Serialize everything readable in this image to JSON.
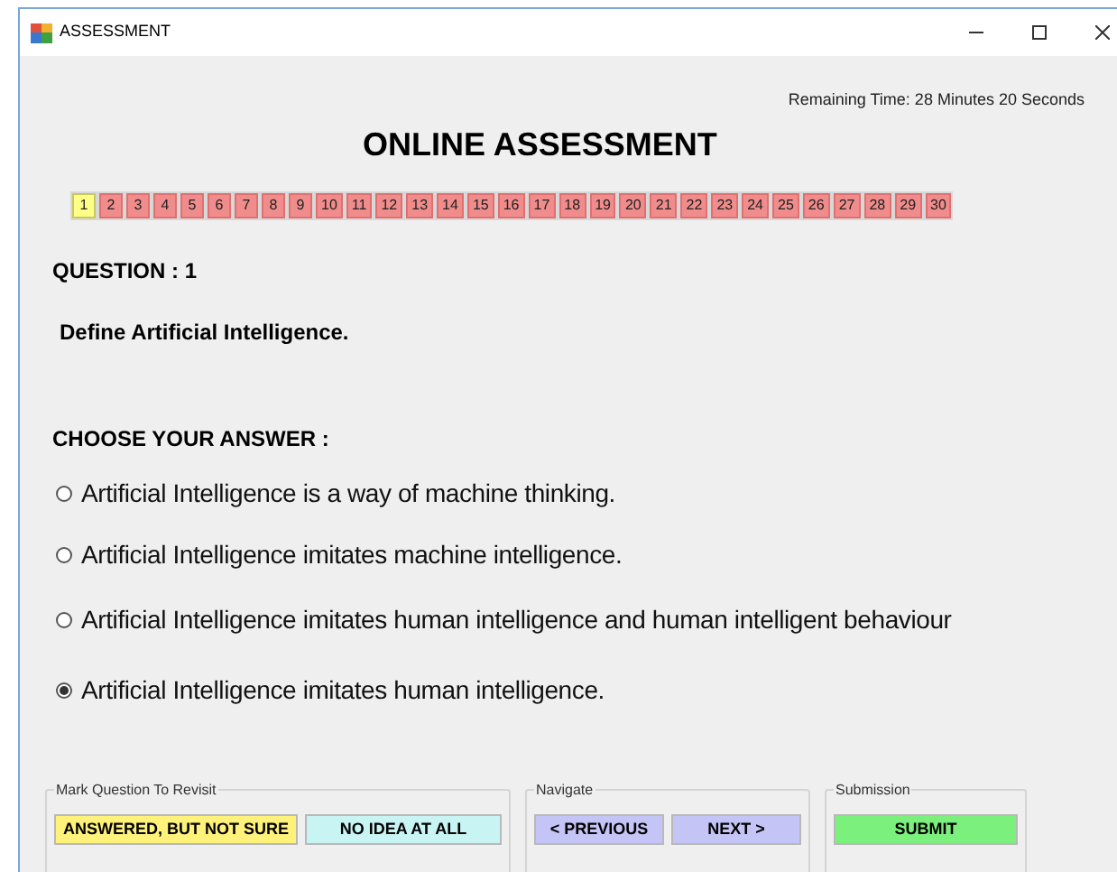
{
  "window": {
    "title": "ASSESSMENT"
  },
  "remaining_time": "Remaining Time: 28 Minutes 20 Seconds",
  "heading": "ONLINE ASSESSMENT",
  "questions": [
    {
      "label": "1",
      "selected": true
    },
    {
      "label": "2",
      "selected": false
    },
    {
      "label": "3",
      "selected": false
    },
    {
      "label": "4",
      "selected": false
    },
    {
      "label": "5",
      "selected": false
    },
    {
      "label": "6",
      "selected": false
    },
    {
      "label": "7",
      "selected": false
    },
    {
      "label": "8",
      "selected": false
    },
    {
      "label": "9",
      "selected": false
    },
    {
      "label": "10",
      "selected": false
    },
    {
      "label": "11",
      "selected": false
    },
    {
      "label": "12",
      "selected": false
    },
    {
      "label": "13",
      "selected": false
    },
    {
      "label": "14",
      "selected": false
    },
    {
      "label": "15",
      "selected": false
    },
    {
      "label": "16",
      "selected": false
    },
    {
      "label": "17",
      "selected": false
    },
    {
      "label": "18",
      "selected": false
    },
    {
      "label": "19",
      "selected": false
    },
    {
      "label": "20",
      "selected": false
    },
    {
      "label": "21",
      "selected": false
    },
    {
      "label": "22",
      "selected": false
    },
    {
      "label": "23",
      "selected": false
    },
    {
      "label": "24",
      "selected": false
    },
    {
      "label": "25",
      "selected": false
    },
    {
      "label": "26",
      "selected": false
    },
    {
      "label": "27",
      "selected": false
    },
    {
      "label": "28",
      "selected": false
    },
    {
      "label": "29",
      "selected": false
    },
    {
      "label": "30",
      "selected": false
    }
  ],
  "question_number": "QUESTION :  1",
  "question_text": "Define Artificial Intelligence.",
  "answer_heading": "CHOOSE YOUR ANSWER :",
  "options": [
    {
      "label": "Artificial Intelligence is a way of machine thinking.",
      "selected": false
    },
    {
      "label": "Artificial Intelligence imitates machine intelligence.",
      "selected": false
    },
    {
      "label": "Artificial Intelligence imitates human intelligence and human intelligent behaviour",
      "selected": false
    },
    {
      "label": "Artificial Intelligence imitates human intelligence.",
      "selected": true
    }
  ],
  "groups": [
    {
      "title": "Mark Question To Revisit",
      "buttons": [
        {
          "label": "ANSWERED, BUT NOT SURE",
          "color": "#fff27a"
        },
        {
          "label": "NO IDEA AT ALL",
          "color": "#c8f4f4"
        }
      ]
    },
    {
      "title": "Navigate",
      "buttons": [
        {
          "label": "< PREVIOUS",
          "color": "#c4c4f7"
        },
        {
          "label": "NEXT >",
          "color": "#c4c4f7"
        }
      ]
    },
    {
      "title": "Submission",
      "buttons": [
        {
          "label": "SUBMIT",
          "color": "#7cf07c"
        }
      ]
    }
  ]
}
